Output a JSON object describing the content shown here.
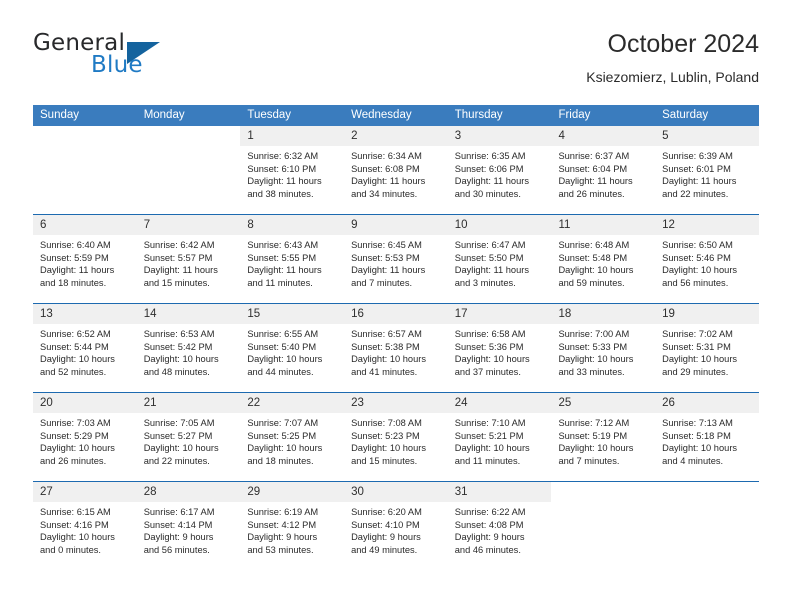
{
  "brand": {
    "name_line1": "General",
    "name_line2": "Blue",
    "flag_icon": "triangle-flag-icon",
    "color_dark": "#28292b",
    "color_blue": "#1f7ac4",
    "color_flag": "#14639e"
  },
  "header": {
    "title": "October 2024",
    "subtitle": "Ksiezomierz, Lublin, Poland"
  },
  "theme": {
    "header_row_bg": "#3a7cbe",
    "header_row_text": "#ffffff",
    "row_divider": "#1d6ab0",
    "daynum_bg": "#f0f0f0",
    "page_bg": "#ffffff",
    "body_text": "#2a2a2a"
  },
  "weekdays": [
    "Sunday",
    "Monday",
    "Tuesday",
    "Wednesday",
    "Thursday",
    "Friday",
    "Saturday"
  ],
  "labels": {
    "sunrise_prefix": "Sunrise:",
    "sunset_prefix": "Sunset:",
    "daylight_prefix": "Daylight:"
  },
  "weeks": [
    [
      {
        "day": "",
        "empty": true
      },
      {
        "day": "",
        "empty": true
      },
      {
        "day": "1",
        "sunrise": "Sunrise: 6:32 AM",
        "sunset": "Sunset: 6:10 PM",
        "daylight_line1": "Daylight: 11 hours",
        "daylight_line2": "and 38 minutes."
      },
      {
        "day": "2",
        "sunrise": "Sunrise: 6:34 AM",
        "sunset": "Sunset: 6:08 PM",
        "daylight_line1": "Daylight: 11 hours",
        "daylight_line2": "and 34 minutes."
      },
      {
        "day": "3",
        "sunrise": "Sunrise: 6:35 AM",
        "sunset": "Sunset: 6:06 PM",
        "daylight_line1": "Daylight: 11 hours",
        "daylight_line2": "and 30 minutes."
      },
      {
        "day": "4",
        "sunrise": "Sunrise: 6:37 AM",
        "sunset": "Sunset: 6:04 PM",
        "daylight_line1": "Daylight: 11 hours",
        "daylight_line2": "and 26 minutes."
      },
      {
        "day": "5",
        "sunrise": "Sunrise: 6:39 AM",
        "sunset": "Sunset: 6:01 PM",
        "daylight_line1": "Daylight: 11 hours",
        "daylight_line2": "and 22 minutes."
      }
    ],
    [
      {
        "day": "6",
        "sunrise": "Sunrise: 6:40 AM",
        "sunset": "Sunset: 5:59 PM",
        "daylight_line1": "Daylight: 11 hours",
        "daylight_line2": "and 18 minutes."
      },
      {
        "day": "7",
        "sunrise": "Sunrise: 6:42 AM",
        "sunset": "Sunset: 5:57 PM",
        "daylight_line1": "Daylight: 11 hours",
        "daylight_line2": "and 15 minutes."
      },
      {
        "day": "8",
        "sunrise": "Sunrise: 6:43 AM",
        "sunset": "Sunset: 5:55 PM",
        "daylight_line1": "Daylight: 11 hours",
        "daylight_line2": "and 11 minutes."
      },
      {
        "day": "9",
        "sunrise": "Sunrise: 6:45 AM",
        "sunset": "Sunset: 5:53 PM",
        "daylight_line1": "Daylight: 11 hours",
        "daylight_line2": "and 7 minutes."
      },
      {
        "day": "10",
        "sunrise": "Sunrise: 6:47 AM",
        "sunset": "Sunset: 5:50 PM",
        "daylight_line1": "Daylight: 11 hours",
        "daylight_line2": "and 3 minutes."
      },
      {
        "day": "11",
        "sunrise": "Sunrise: 6:48 AM",
        "sunset": "Sunset: 5:48 PM",
        "daylight_line1": "Daylight: 10 hours",
        "daylight_line2": "and 59 minutes."
      },
      {
        "day": "12",
        "sunrise": "Sunrise: 6:50 AM",
        "sunset": "Sunset: 5:46 PM",
        "daylight_line1": "Daylight: 10 hours",
        "daylight_line2": "and 56 minutes."
      }
    ],
    [
      {
        "day": "13",
        "sunrise": "Sunrise: 6:52 AM",
        "sunset": "Sunset: 5:44 PM",
        "daylight_line1": "Daylight: 10 hours",
        "daylight_line2": "and 52 minutes."
      },
      {
        "day": "14",
        "sunrise": "Sunrise: 6:53 AM",
        "sunset": "Sunset: 5:42 PM",
        "daylight_line1": "Daylight: 10 hours",
        "daylight_line2": "and 48 minutes."
      },
      {
        "day": "15",
        "sunrise": "Sunrise: 6:55 AM",
        "sunset": "Sunset: 5:40 PM",
        "daylight_line1": "Daylight: 10 hours",
        "daylight_line2": "and 44 minutes."
      },
      {
        "day": "16",
        "sunrise": "Sunrise: 6:57 AM",
        "sunset": "Sunset: 5:38 PM",
        "daylight_line1": "Daylight: 10 hours",
        "daylight_line2": "and 41 minutes."
      },
      {
        "day": "17",
        "sunrise": "Sunrise: 6:58 AM",
        "sunset": "Sunset: 5:36 PM",
        "daylight_line1": "Daylight: 10 hours",
        "daylight_line2": "and 37 minutes."
      },
      {
        "day": "18",
        "sunrise": "Sunrise: 7:00 AM",
        "sunset": "Sunset: 5:33 PM",
        "daylight_line1": "Daylight: 10 hours",
        "daylight_line2": "and 33 minutes."
      },
      {
        "day": "19",
        "sunrise": "Sunrise: 7:02 AM",
        "sunset": "Sunset: 5:31 PM",
        "daylight_line1": "Daylight: 10 hours",
        "daylight_line2": "and 29 minutes."
      }
    ],
    [
      {
        "day": "20",
        "sunrise": "Sunrise: 7:03 AM",
        "sunset": "Sunset: 5:29 PM",
        "daylight_line1": "Daylight: 10 hours",
        "daylight_line2": "and 26 minutes."
      },
      {
        "day": "21",
        "sunrise": "Sunrise: 7:05 AM",
        "sunset": "Sunset: 5:27 PM",
        "daylight_line1": "Daylight: 10 hours",
        "daylight_line2": "and 22 minutes."
      },
      {
        "day": "22",
        "sunrise": "Sunrise: 7:07 AM",
        "sunset": "Sunset: 5:25 PM",
        "daylight_line1": "Daylight: 10 hours",
        "daylight_line2": "and 18 minutes."
      },
      {
        "day": "23",
        "sunrise": "Sunrise: 7:08 AM",
        "sunset": "Sunset: 5:23 PM",
        "daylight_line1": "Daylight: 10 hours",
        "daylight_line2": "and 15 minutes."
      },
      {
        "day": "24",
        "sunrise": "Sunrise: 7:10 AM",
        "sunset": "Sunset: 5:21 PM",
        "daylight_line1": "Daylight: 10 hours",
        "daylight_line2": "and 11 minutes."
      },
      {
        "day": "25",
        "sunrise": "Sunrise: 7:12 AM",
        "sunset": "Sunset: 5:19 PM",
        "daylight_line1": "Daylight: 10 hours",
        "daylight_line2": "and 7 minutes."
      },
      {
        "day": "26",
        "sunrise": "Sunrise: 7:13 AM",
        "sunset": "Sunset: 5:18 PM",
        "daylight_line1": "Daylight: 10 hours",
        "daylight_line2": "and 4 minutes."
      }
    ],
    [
      {
        "day": "27",
        "sunrise": "Sunrise: 6:15 AM",
        "sunset": "Sunset: 4:16 PM",
        "daylight_line1": "Daylight: 10 hours",
        "daylight_line2": "and 0 minutes."
      },
      {
        "day": "28",
        "sunrise": "Sunrise: 6:17 AM",
        "sunset": "Sunset: 4:14 PM",
        "daylight_line1": "Daylight: 9 hours",
        "daylight_line2": "and 56 minutes."
      },
      {
        "day": "29",
        "sunrise": "Sunrise: 6:19 AM",
        "sunset": "Sunset: 4:12 PM",
        "daylight_line1": "Daylight: 9 hours",
        "daylight_line2": "and 53 minutes."
      },
      {
        "day": "30",
        "sunrise": "Sunrise: 6:20 AM",
        "sunset": "Sunset: 4:10 PM",
        "daylight_line1": "Daylight: 9 hours",
        "daylight_line2": "and 49 minutes."
      },
      {
        "day": "31",
        "sunrise": "Sunrise: 6:22 AM",
        "sunset": "Sunset: 4:08 PM",
        "daylight_line1": "Daylight: 9 hours",
        "daylight_line2": "and 46 minutes."
      },
      {
        "day": "",
        "empty": true
      },
      {
        "day": "",
        "empty": true
      }
    ]
  ]
}
